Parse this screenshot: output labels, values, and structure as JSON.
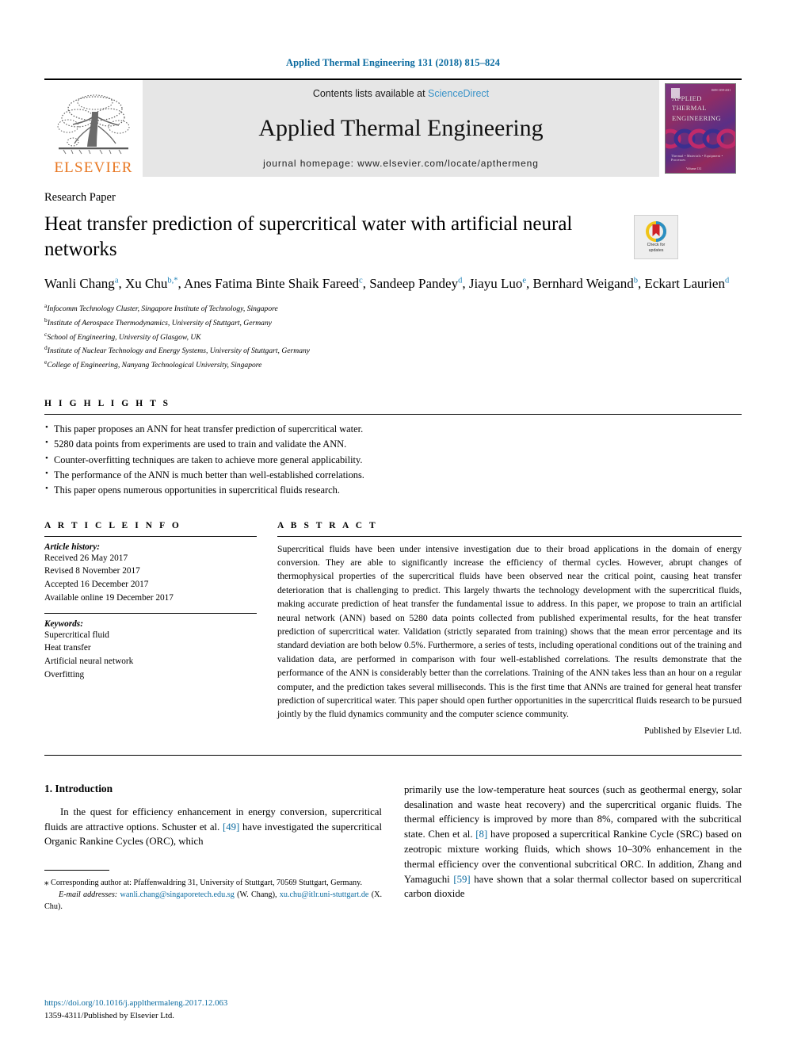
{
  "running_head": "Applied Thermal Engineering 131 (2018) 815–824",
  "masthead": {
    "publisher_name": "ELSEVIER",
    "contents_prefix": "Contents lists available at ",
    "sciencedirect": "ScienceDirect",
    "journal_title": "Applied Thermal Engineering",
    "homepage": "journal homepage: www.elsevier.com/locate/apthermeng",
    "cover": {
      "line1": "APPLIED",
      "line2": "THERMAL",
      "line3": "ENGINEERING",
      "footer": "Thermal • Materials • Equipment • Processes",
      "footer2": "Volume 131",
      "corner": "ISSN 1359-4311"
    }
  },
  "article": {
    "type": "Research Paper",
    "title": "Heat transfer prediction of supercritical water with artificial neural networks",
    "crossmark_line1": "Check for",
    "crossmark_line2": "updates",
    "authors": [
      {
        "name": "Wanli Chang",
        "sup": "a",
        "sep": ", "
      },
      {
        "name": "Xu Chu",
        "sup": "b,*",
        "sep": ", "
      },
      {
        "name": "Anes Fatima Binte Shaik Fareed",
        "sup": "c",
        "sep": ", "
      },
      {
        "name": "Sandeep Pandey",
        "sup": "d",
        "sep": ", "
      },
      {
        "name": "Jiayu Luo",
        "sup": "e",
        "sep": ", "
      },
      {
        "name": "Bernhard Weigand",
        "sup": "b",
        "sep": ", "
      },
      {
        "name": "Eckart Laurien",
        "sup": "d",
        "sep": ""
      }
    ],
    "affiliations": [
      {
        "mark": "a",
        "text": "Infocomm Technology Cluster, Singapore Institute of Technology, Singapore"
      },
      {
        "mark": "b",
        "text": "Institute of Aerospace Thermodynamics, University of Stuttgart, Germany"
      },
      {
        "mark": "c",
        "text": "School of Engineering, University of Glasgow, UK"
      },
      {
        "mark": "d",
        "text": "Institute of Nuclear Technology and Energy Systems, University of Stuttgart, Germany"
      },
      {
        "mark": "e",
        "text": "College of Engineering, Nanyang Technological University, Singapore"
      }
    ]
  },
  "highlights": {
    "label": "H I G H L I G H T S",
    "items": [
      "This paper proposes an ANN for heat transfer prediction of supercritical water.",
      "5280 data points from experiments are used to train and validate the ANN.",
      "Counter-overfitting techniques are taken to achieve more general applicability.",
      "The performance of the ANN is much better than well-established correlations.",
      "This paper opens numerous opportunities in supercritical fluids research."
    ]
  },
  "article_info": {
    "label": "A R T I C L E   I N F O",
    "history_label": "Article history:",
    "history": [
      "Received 26 May 2017",
      "Revised 8 November 2017",
      "Accepted 16 December 2017",
      "Available online 19 December 2017"
    ],
    "keywords_label": "Keywords:",
    "keywords": [
      "Supercritical fluid",
      "Heat transfer",
      "Artificial neural network",
      "Overfitting"
    ]
  },
  "abstract": {
    "label": "A B S T R A C T",
    "text": "Supercritical fluids have been under intensive investigation due to their broad applications in the domain of energy conversion. They are able to significantly increase the efficiency of thermal cycles. However, abrupt changes of thermophysical properties of the supercritical fluids have been observed near the critical point, causing heat transfer deterioration that is challenging to predict. This largely thwarts the technology development with the supercritical fluids, making accurate prediction of heat transfer the fundamental issue to address. In this paper, we propose to train an artificial neural network (ANN) based on 5280 data points collected from published experimental results, for the heat transfer prediction of supercritical water. Validation (strictly separated from training) shows that the mean error percentage and its standard deviation are both below 0.5%. Furthermore, a series of tests, including operational conditions out of the training and validation data, are performed in comparison with four well-established correlations. The results demonstrate that the performance of the ANN is considerably better than the correlations. Training of the ANN takes less than an hour on a regular computer, and the prediction takes several milliseconds. This is the first time that ANNs are trained for general heat transfer prediction of supercritical water. This paper should open further opportunities in the supercritical fluids research to be pursued jointly by the fluid dynamics community and the computer science community.",
    "publisher_note": "Published by Elsevier Ltd."
  },
  "introduction": {
    "heading": "1. Introduction",
    "left_para_a": "In the quest for efficiency enhancement in energy conversion, supercritical fluids are attractive options. Schuster et al. ",
    "left_ref_a": "[49]",
    "left_para_b": " have investigated the supercritical Organic Rankine Cycles (ORC), which",
    "right_para_a": "primarily use the low-temperature heat sources (such as geothermal energy, solar desalination and waste heat recovery) and the supercritical organic fluids. The thermal efficiency is improved by more than 8%, compared with the subcritical state. Chen et al. ",
    "right_ref_a": "[8]",
    "right_para_b": " have proposed a supercritical Rankine Cycle (SRC) based on zeotropic mixture working fluids, which shows 10–30% enhancement in the thermal efficiency over the conventional subcritical ORC. In addition, Zhang and Yamaguchi ",
    "right_ref_b": "[59]",
    "right_para_c": " have shown that a solar thermal collector based on supercritical carbon dioxide"
  },
  "footnote": {
    "star": "⁎",
    "corresponding": " Corresponding author at: Pfaffenwaldring 31, University of Stuttgart, 70569 Stuttgart, Germany.",
    "email_label": "E-mail addresses:",
    "email1": "wanli.chang@singaporetech.edu.sg",
    "email1_owner": " (W. Chang), ",
    "email2": "xu.chu@itlr.uni-stuttgart.de",
    "email2_owner": " (X. Chu)."
  },
  "footer": {
    "doi": "https://doi.org/10.1016/j.applthermaleng.2017.12.063",
    "issn_line": "1359-4311/Published by Elsevier Ltd."
  },
  "colors": {
    "link_blue": "#0b6ba0",
    "sciencedirect_blue": "#3a93c8",
    "elsevier_orange": "#E87722",
    "superscript_blue": "#1b7fb5",
    "masthead_gray": "#e6e6e6"
  }
}
